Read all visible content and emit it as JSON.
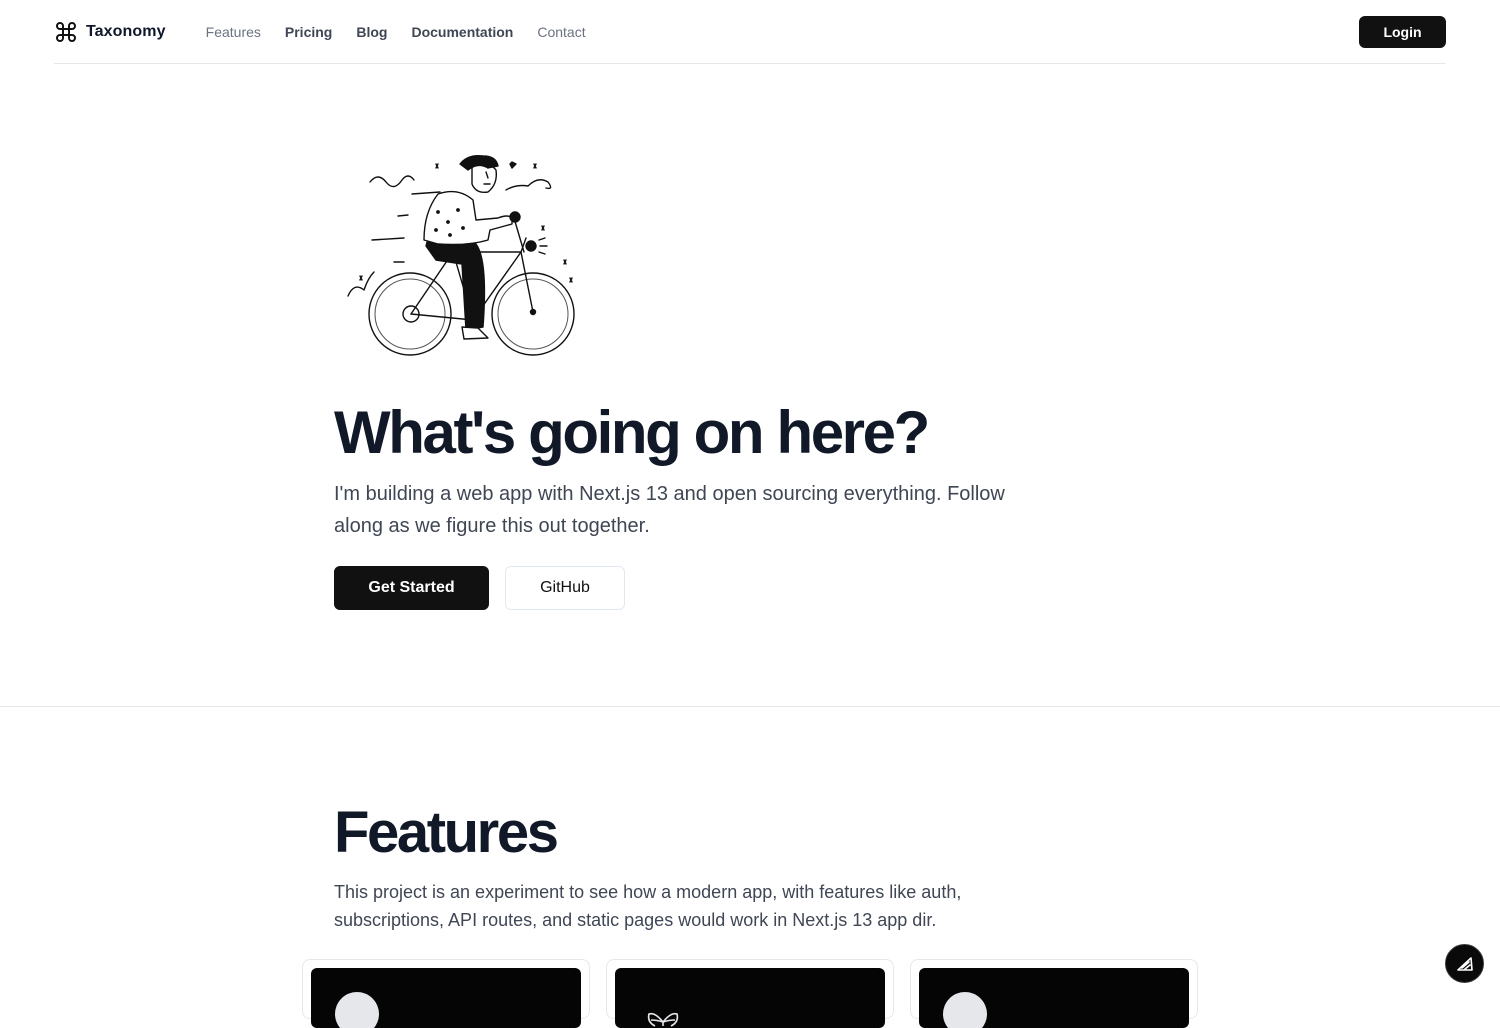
{
  "header": {
    "brand_name": "Taxonomy",
    "brand_icon": "command-icon",
    "nav": [
      {
        "label": "Features"
      },
      {
        "label": "Pricing"
      },
      {
        "label": "Blog"
      },
      {
        "label": "Documentation"
      },
      {
        "label": "Contact"
      }
    ],
    "login_label": "Login"
  },
  "hero": {
    "illustration": "person-riding-bicycle",
    "title": "What's going on here?",
    "description": "I'm building a web app with Next.js 13 and open sourcing everything. Follow along as we figure this out together.",
    "primary_cta": "Get Started",
    "secondary_cta": "GitHub"
  },
  "features": {
    "title": "Features",
    "description": "This project is an experiment to see how a modern app, with features like auth, subscriptions, API routes, and static pages would work in Next.js 13 app dir.",
    "cards": [
      {
        "icon": "circle-logo-icon"
      },
      {
        "icon": "butterfly-icon"
      },
      {
        "icon": "circle-logo-icon"
      }
    ]
  },
  "floating_button": {
    "icon": "edit-triangle-icon"
  },
  "colors": {
    "primary": "#111111",
    "text": "#111827",
    "muted": "#6b7280",
    "border": "#e5e7eb"
  }
}
